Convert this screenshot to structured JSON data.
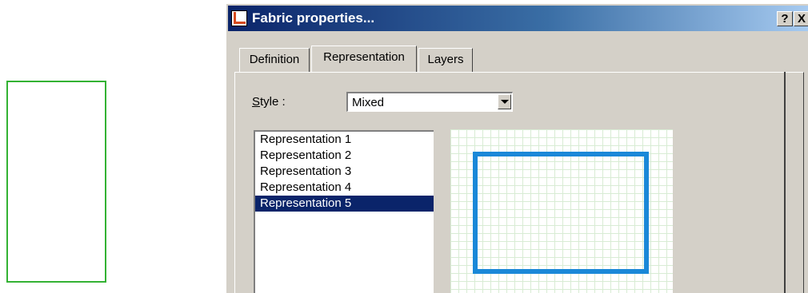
{
  "window": {
    "title": "Fabric properties...",
    "help_button": "?",
    "close_button": "X"
  },
  "tabs": [
    {
      "label": "Definition",
      "active": false
    },
    {
      "label": "Representation",
      "active": true
    },
    {
      "label": "Layers",
      "active": false
    }
  ],
  "style": {
    "label_accel": "S",
    "label_rest": "tyle :",
    "selected": "Mixed"
  },
  "representations": {
    "items": [
      "Representation 1",
      "Representation 2",
      "Representation 3",
      "Representation 4",
      "Representation 5"
    ],
    "selected_index": 4
  },
  "colors": {
    "preview_outline": "#1a88d8",
    "side_outline": "#33b233",
    "selection": "#0a246a"
  }
}
